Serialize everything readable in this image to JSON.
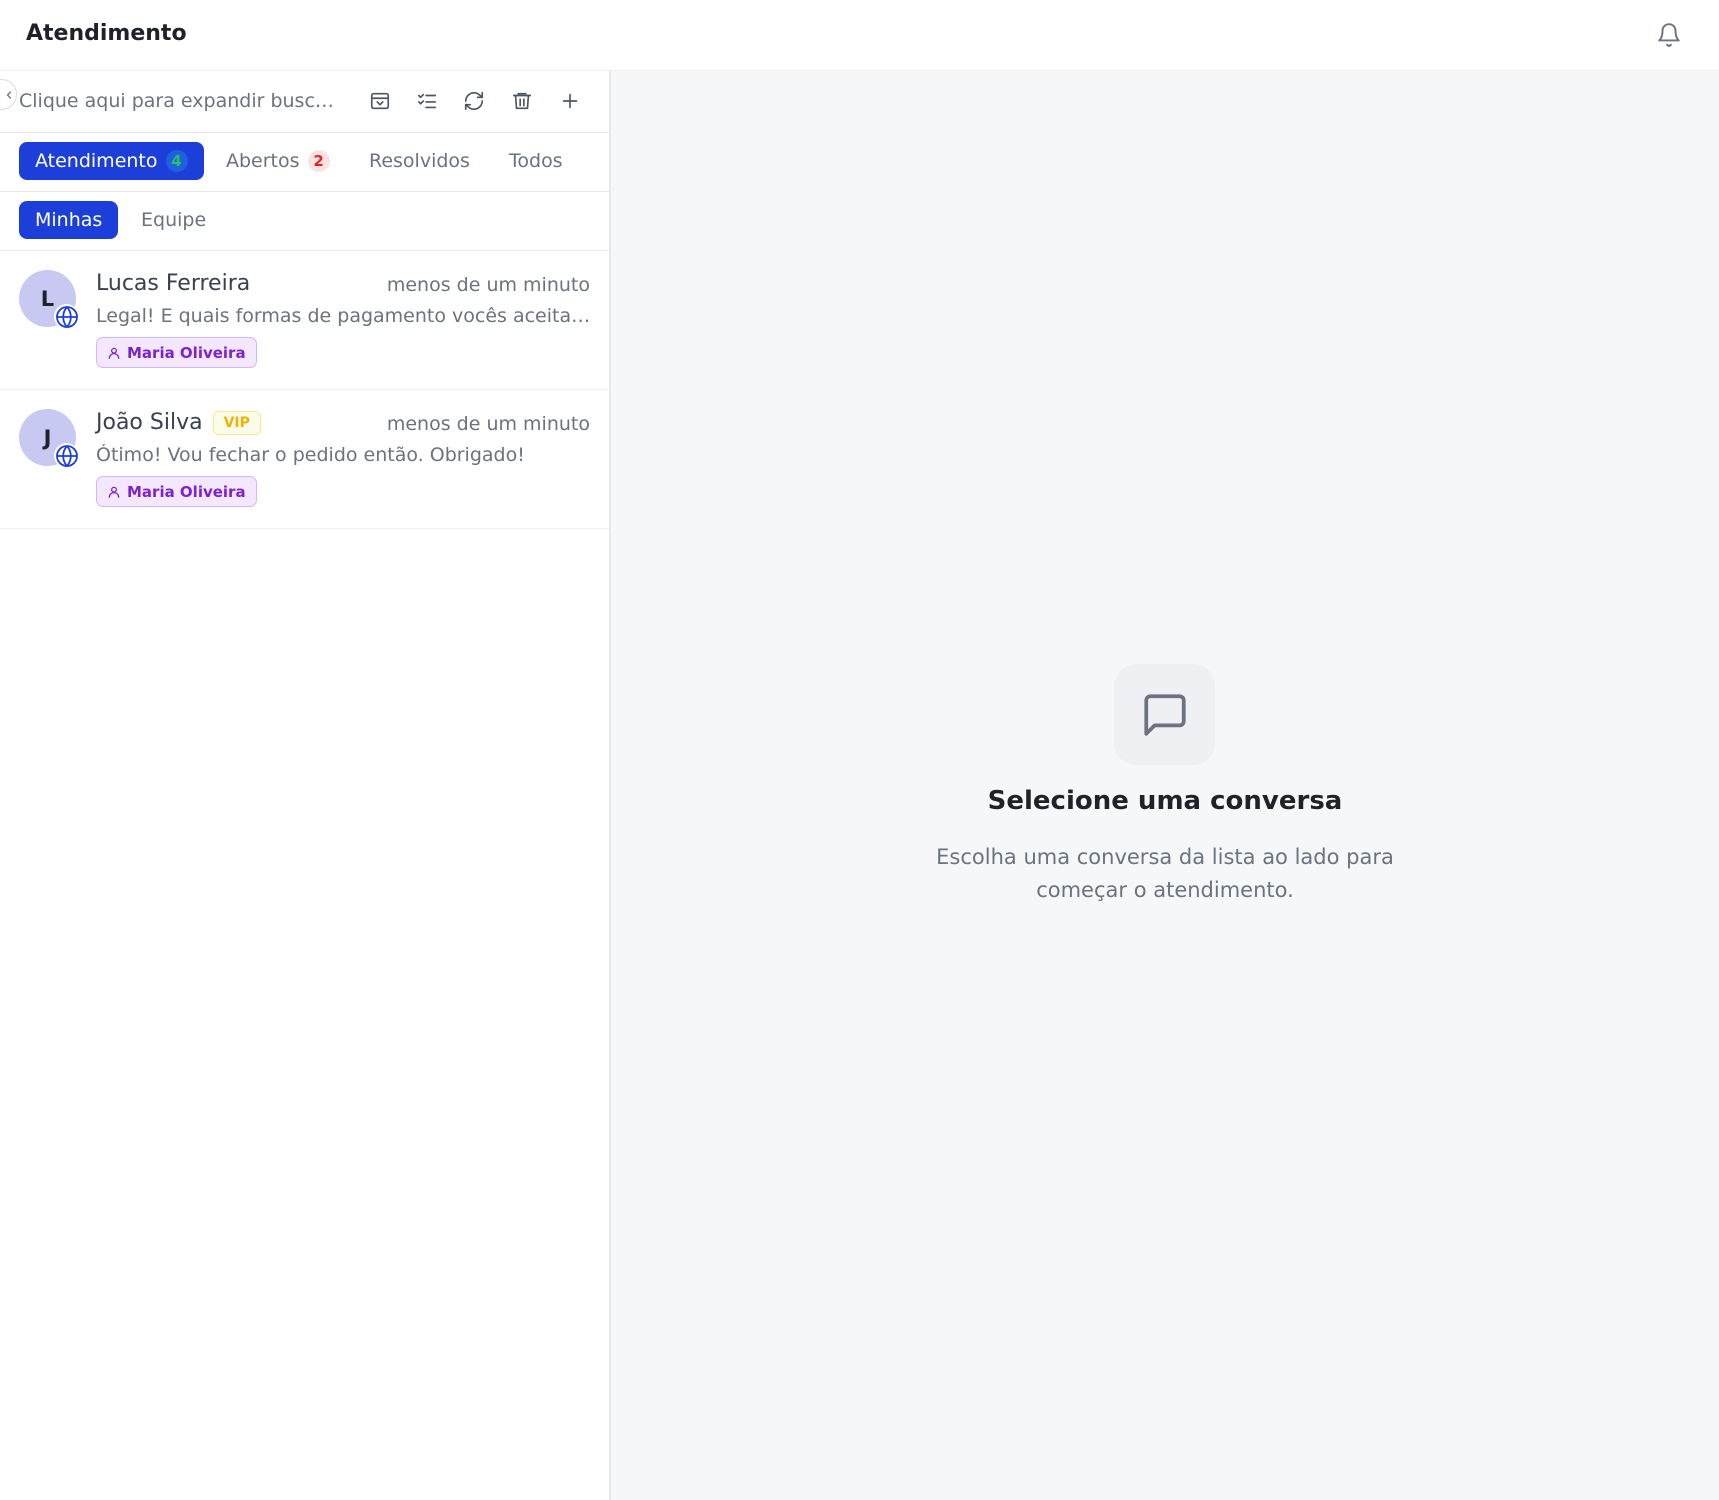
{
  "header": {
    "title": "Atendimento",
    "bell_icon": "bell-icon"
  },
  "search": {
    "placeholder": "Clique aqui para expandir busca..."
  },
  "toolbar": {
    "icons": [
      "archive-icon",
      "checklist-icon",
      "refresh-icon",
      "trash-icon",
      "plus-icon"
    ]
  },
  "tabs": [
    {
      "label": "Atendimento",
      "count": "4",
      "active": true
    },
    {
      "label": "Abertos",
      "count": "2",
      "active": false
    },
    {
      "label": "Resolvidos",
      "count": "",
      "active": false
    },
    {
      "label": "Todos",
      "count": "",
      "active": false
    }
  ],
  "subtabs": [
    {
      "label": "Minhas",
      "active": true
    },
    {
      "label": "Equipe",
      "active": false
    }
  ],
  "conversations": [
    {
      "initial": "L",
      "name": "Lucas Ferreira",
      "badge": "",
      "time": "menos de um minuto",
      "message": "Legal! E quais formas de pagamento vocês aceitam?",
      "agent": "Maria Oliveira",
      "channel_icon": "globe-icon"
    },
    {
      "initial": "J",
      "name": "João Silva",
      "badge": "VIP",
      "time": "menos de um minuto",
      "message": "Ótimo! Vou fechar o pedido então. Obrigado!",
      "agent": "Maria Oliveira",
      "channel_icon": "globe-icon"
    }
  ],
  "empty_state": {
    "icon": "message-square-icon",
    "title": "Selecione uma conversa",
    "text": "Escolha uma conversa da lista ao lado para começar o atendimento."
  },
  "colors": {
    "accent": "#1d3fd9",
    "panel_bg": "#f6f7f9",
    "avatar_bg": "#c7c9f3",
    "agent_tag": "#7e22ce",
    "vip": "#eab308"
  }
}
